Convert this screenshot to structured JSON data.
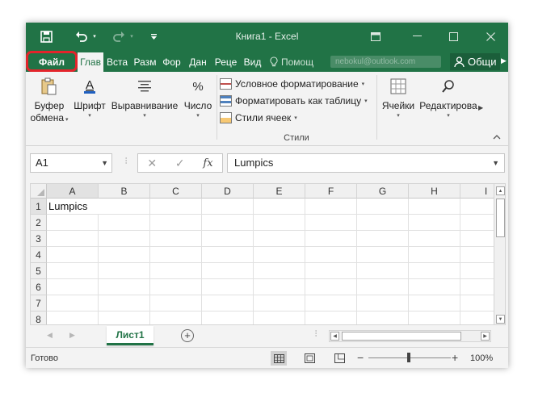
{
  "window": {
    "title": "Книга1 - Excel",
    "account_text": "nebokul@outlook.com",
    "share_label": "Общи",
    "tell_me_label": "Помощ"
  },
  "tabs": [
    {
      "label": "Файл",
      "highlighted": true
    },
    {
      "label": "Глав",
      "active": true
    },
    {
      "label": "Вста"
    },
    {
      "label": "Разм"
    },
    {
      "label": "Фор"
    },
    {
      "label": "Дан"
    },
    {
      "label": "Реце"
    },
    {
      "label": "Вид"
    }
  ],
  "ribbon": {
    "clipboard": {
      "line1": "Буфер",
      "line2": "обмена"
    },
    "font": {
      "label": "Шрифт"
    },
    "alignment": {
      "label": "Выравнивание"
    },
    "number": {
      "label": "Число"
    },
    "styles": {
      "conditional": "Условное форматирование",
      "table": "Форматировать как таблицу",
      "cell_styles": "Стили ячеек",
      "caption": "Стили"
    },
    "cells": {
      "label": "Ячейки"
    },
    "editing": {
      "label": "Редактирова"
    }
  },
  "formula_bar": {
    "name_box": "A1",
    "fx_label": "fx",
    "value": "Lumpics"
  },
  "grid": {
    "columns": [
      "A",
      "B",
      "C",
      "D",
      "E",
      "F",
      "G",
      "H",
      "I"
    ],
    "rows": [
      "1",
      "2",
      "3",
      "4",
      "5",
      "6",
      "7",
      "8"
    ],
    "cell_a1": "Lumpics"
  },
  "sheets": [
    {
      "label": "Лист1",
      "active": true
    }
  ],
  "status": {
    "text": "Готово",
    "zoom": "100%",
    "zoom_level_percent": 100
  },
  "colors": {
    "accent": "#217346",
    "highlight_ring": "#e3242b"
  }
}
